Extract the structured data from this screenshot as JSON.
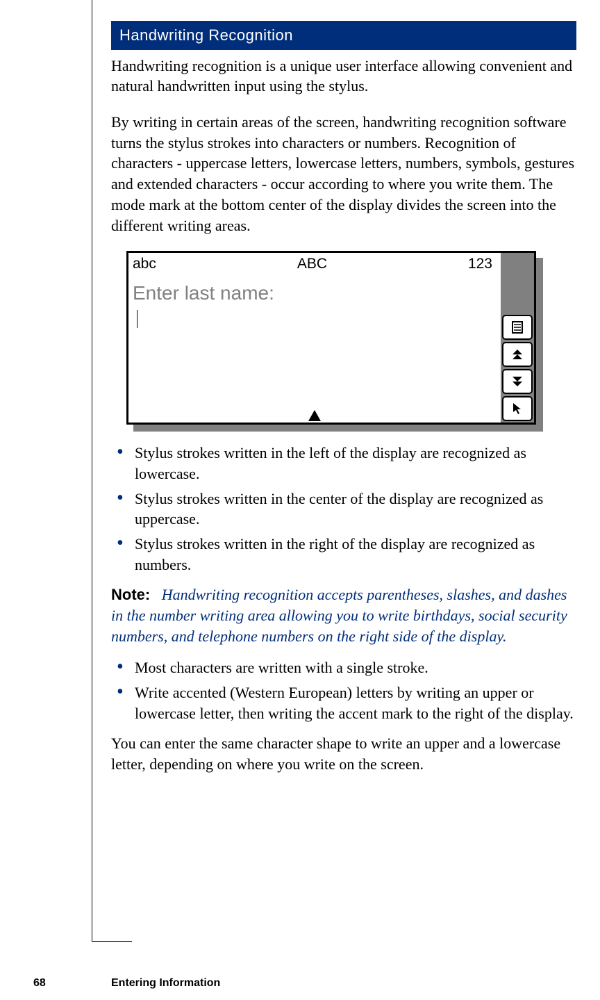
{
  "heading": "Handwriting Recognition",
  "intro_para_1": "Handwriting recognition is a unique user interface allowing convenient and natural handwritten input using the stylus.",
  "intro_para_2": "By writing in certain areas of the screen, handwriting recognition software turns the stylus strokes into characters or numbers. Recognition of characters - uppercase letters, lowercase letters, numbers, symbols, gestures and extended characters - occur according to where you write them. The mode mark at the bottom center of the display divides the screen into the different writing areas.",
  "figure": {
    "mode_labels": {
      "left": "abc",
      "center": "ABC",
      "right": "123"
    },
    "prompt_text": "Enter last name:",
    "side_buttons": [
      "menu-icon",
      "scroll-up-icon",
      "scroll-down-icon",
      "pointer-icon"
    ]
  },
  "bullets_1": [
    "Stylus strokes written in the left of the display are recognized as lowercase.",
    "Stylus strokes written in the center of the display are recognized as uppercase.",
    "Stylus strokes written in the right of the display are recognized as numbers."
  ],
  "note": {
    "label": "Note:",
    "body": "Handwriting recognition accepts parentheses, slashes, and dashes in the number writing area allowing you to write birthdays, social security numbers, and telephone numbers on the right side of the display."
  },
  "bullets_2": [
    "Most characters are written with a single stroke.",
    "Write accented (Western European) letters by writing an upper or lowercase letter, then writing the accent mark to the right of the display."
  ],
  "closing_para": "You can enter the same character shape to write an upper and a lowercase letter, depending on where you write on the screen.",
  "footer": {
    "page_number": "68",
    "chapter_title": "Entering Information"
  }
}
